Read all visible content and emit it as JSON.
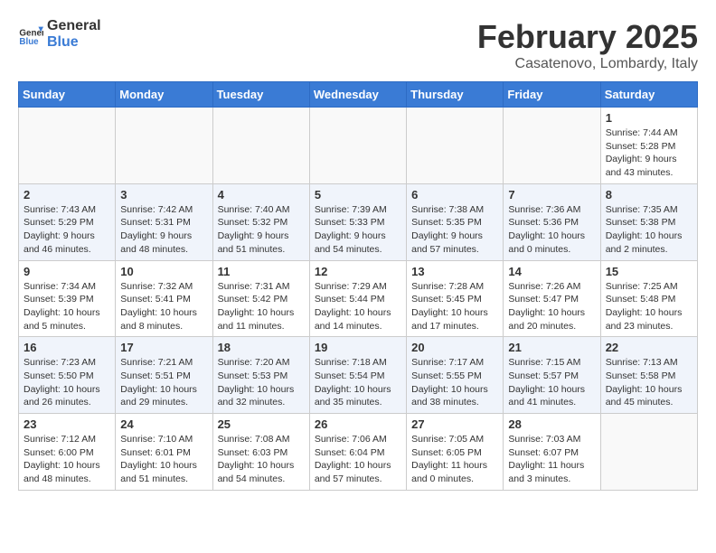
{
  "header": {
    "logo_general": "General",
    "logo_blue": "Blue",
    "title": "February 2025",
    "subtitle": "Casatenovo, Lombardy, Italy"
  },
  "weekdays": [
    "Sunday",
    "Monday",
    "Tuesday",
    "Wednesday",
    "Thursday",
    "Friday",
    "Saturday"
  ],
  "weeks": [
    [
      {
        "day": "",
        "info": ""
      },
      {
        "day": "",
        "info": ""
      },
      {
        "day": "",
        "info": ""
      },
      {
        "day": "",
        "info": ""
      },
      {
        "day": "",
        "info": ""
      },
      {
        "day": "",
        "info": ""
      },
      {
        "day": "1",
        "info": "Sunrise: 7:44 AM\nSunset: 5:28 PM\nDaylight: 9 hours and 43 minutes."
      }
    ],
    [
      {
        "day": "2",
        "info": "Sunrise: 7:43 AM\nSunset: 5:29 PM\nDaylight: 9 hours and 46 minutes."
      },
      {
        "day": "3",
        "info": "Sunrise: 7:42 AM\nSunset: 5:31 PM\nDaylight: 9 hours and 48 minutes."
      },
      {
        "day": "4",
        "info": "Sunrise: 7:40 AM\nSunset: 5:32 PM\nDaylight: 9 hours and 51 minutes."
      },
      {
        "day": "5",
        "info": "Sunrise: 7:39 AM\nSunset: 5:33 PM\nDaylight: 9 hours and 54 minutes."
      },
      {
        "day": "6",
        "info": "Sunrise: 7:38 AM\nSunset: 5:35 PM\nDaylight: 9 hours and 57 minutes."
      },
      {
        "day": "7",
        "info": "Sunrise: 7:36 AM\nSunset: 5:36 PM\nDaylight: 10 hours and 0 minutes."
      },
      {
        "day": "8",
        "info": "Sunrise: 7:35 AM\nSunset: 5:38 PM\nDaylight: 10 hours and 2 minutes."
      }
    ],
    [
      {
        "day": "9",
        "info": "Sunrise: 7:34 AM\nSunset: 5:39 PM\nDaylight: 10 hours and 5 minutes."
      },
      {
        "day": "10",
        "info": "Sunrise: 7:32 AM\nSunset: 5:41 PM\nDaylight: 10 hours and 8 minutes."
      },
      {
        "day": "11",
        "info": "Sunrise: 7:31 AM\nSunset: 5:42 PM\nDaylight: 10 hours and 11 minutes."
      },
      {
        "day": "12",
        "info": "Sunrise: 7:29 AM\nSunset: 5:44 PM\nDaylight: 10 hours and 14 minutes."
      },
      {
        "day": "13",
        "info": "Sunrise: 7:28 AM\nSunset: 5:45 PM\nDaylight: 10 hours and 17 minutes."
      },
      {
        "day": "14",
        "info": "Sunrise: 7:26 AM\nSunset: 5:47 PM\nDaylight: 10 hours and 20 minutes."
      },
      {
        "day": "15",
        "info": "Sunrise: 7:25 AM\nSunset: 5:48 PM\nDaylight: 10 hours and 23 minutes."
      }
    ],
    [
      {
        "day": "16",
        "info": "Sunrise: 7:23 AM\nSunset: 5:50 PM\nDaylight: 10 hours and 26 minutes."
      },
      {
        "day": "17",
        "info": "Sunrise: 7:21 AM\nSunset: 5:51 PM\nDaylight: 10 hours and 29 minutes."
      },
      {
        "day": "18",
        "info": "Sunrise: 7:20 AM\nSunset: 5:53 PM\nDaylight: 10 hours and 32 minutes."
      },
      {
        "day": "19",
        "info": "Sunrise: 7:18 AM\nSunset: 5:54 PM\nDaylight: 10 hours and 35 minutes."
      },
      {
        "day": "20",
        "info": "Sunrise: 7:17 AM\nSunset: 5:55 PM\nDaylight: 10 hours and 38 minutes."
      },
      {
        "day": "21",
        "info": "Sunrise: 7:15 AM\nSunset: 5:57 PM\nDaylight: 10 hours and 41 minutes."
      },
      {
        "day": "22",
        "info": "Sunrise: 7:13 AM\nSunset: 5:58 PM\nDaylight: 10 hours and 45 minutes."
      }
    ],
    [
      {
        "day": "23",
        "info": "Sunrise: 7:12 AM\nSunset: 6:00 PM\nDaylight: 10 hours and 48 minutes."
      },
      {
        "day": "24",
        "info": "Sunrise: 7:10 AM\nSunset: 6:01 PM\nDaylight: 10 hours and 51 minutes."
      },
      {
        "day": "25",
        "info": "Sunrise: 7:08 AM\nSunset: 6:03 PM\nDaylight: 10 hours and 54 minutes."
      },
      {
        "day": "26",
        "info": "Sunrise: 7:06 AM\nSunset: 6:04 PM\nDaylight: 10 hours and 57 minutes."
      },
      {
        "day": "27",
        "info": "Sunrise: 7:05 AM\nSunset: 6:05 PM\nDaylight: 11 hours and 0 minutes."
      },
      {
        "day": "28",
        "info": "Sunrise: 7:03 AM\nSunset: 6:07 PM\nDaylight: 11 hours and 3 minutes."
      },
      {
        "day": "",
        "info": ""
      }
    ]
  ]
}
